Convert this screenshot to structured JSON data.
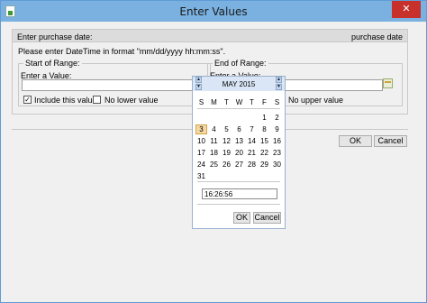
{
  "window": {
    "title": "Enter Values",
    "close_glyph": "✕"
  },
  "panel": {
    "label": "Enter purchase date:",
    "field_name": "purchase date",
    "hint": "Please enter DateTime in format \"mm/dd/yyyy hh:mm:ss\"."
  },
  "start_range": {
    "title": "Start of Range:",
    "value_label": "Enter a Value:",
    "value": "",
    "include_label": "Include this value",
    "include_checked": true,
    "no_bound_label": "No lower value"
  },
  "end_range": {
    "title": "End of Range:",
    "value_label": "Enter a Value:",
    "value": "",
    "no_bound_label": "No upper value"
  },
  "dialog_buttons": {
    "ok": "OK",
    "cancel": "Cancel"
  },
  "calendar": {
    "month_year": "MAY  2015",
    "weekdays": [
      "S",
      "M",
      "T",
      "W",
      "T",
      "F",
      "S"
    ],
    "weeks": [
      [
        "",
        "",
        "",
        "",
        "",
        "1",
        "2"
      ],
      [
        "3",
        "4",
        "5",
        "6",
        "7",
        "8",
        "9"
      ],
      [
        "10",
        "11",
        "12",
        "13",
        "14",
        "15",
        "16"
      ],
      [
        "17",
        "18",
        "19",
        "20",
        "21",
        "22",
        "23"
      ],
      [
        "24",
        "25",
        "26",
        "27",
        "28",
        "29",
        "30"
      ],
      [
        "31",
        "",
        "",
        "",
        "",
        "",
        ""
      ]
    ],
    "selected_day": "3",
    "time": "16:26:56",
    "ok": "OK",
    "cancel": "Cancel",
    "icons": [
      "calendar-icon",
      "spin-up-icon",
      "spin-down-icon",
      "check-icon"
    ]
  }
}
